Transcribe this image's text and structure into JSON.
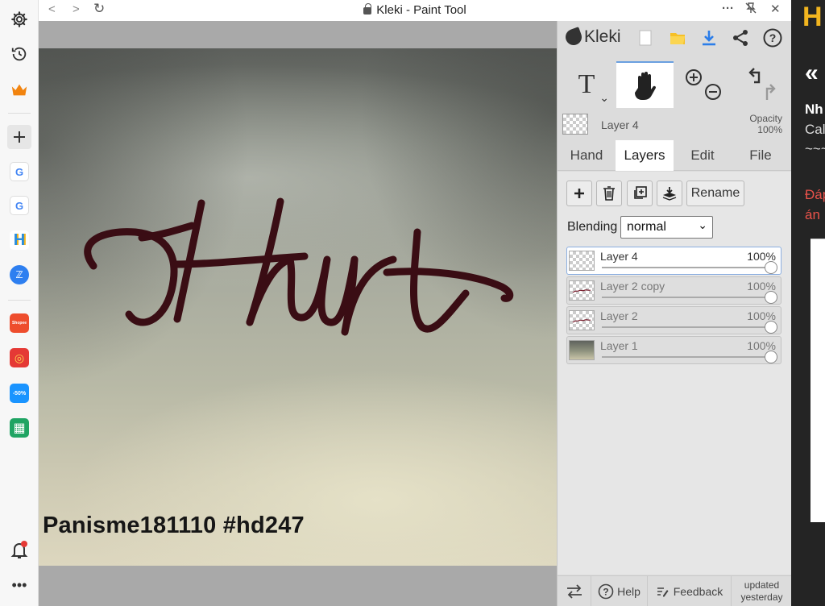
{
  "window": {
    "title": "Kleki - Paint Tool",
    "back_icon": "chevron-left-icon",
    "forward_icon": "chevron-right-icon",
    "reload_icon": "reload-icon",
    "more_label": "···"
  },
  "sidebar": {
    "apps": [
      {
        "name": "google-1",
        "label": "G",
        "color": "#ffffff"
      },
      {
        "name": "google-2",
        "label": "G",
        "color": "#ffffff"
      },
      {
        "name": "hocmai",
        "label": "H",
        "color": "#ffffff"
      },
      {
        "name": "zalo",
        "label": "ℤ",
        "color": "#2e7ff0"
      },
      {
        "name": "shopee",
        "label": "Shopee",
        "color": "#ee4d2d"
      },
      {
        "name": "lazada-game",
        "label": "◎",
        "color": "#e53935"
      },
      {
        "name": "tiki",
        "label": "-50%",
        "color": "#1a94ff"
      },
      {
        "name": "sheets",
        "label": "▦",
        "color": "#1fa463"
      }
    ]
  },
  "canvas": {
    "watermark": "Panisme181110 #hd247",
    "stroke_color": "#3a0d14"
  },
  "panel": {
    "logo": "Kleki",
    "tools": {
      "text_label": "T",
      "active_tool": "hand"
    },
    "current_layer": {
      "name": "Layer 4",
      "opacity_label": "Opacity",
      "opacity_value": "100%"
    },
    "tabs": [
      {
        "label": "Hand",
        "active": false
      },
      {
        "label": "Layers",
        "active": true
      },
      {
        "label": "Edit",
        "active": false
      },
      {
        "label": "File",
        "active": false
      }
    ],
    "layer_actions": {
      "rename_label": "Rename"
    },
    "blending": {
      "label": "Blending",
      "value": "normal"
    },
    "layers": [
      {
        "name": "Layer 4",
        "opacity": "100%",
        "selected": true,
        "thumb": "transparent"
      },
      {
        "name": "Layer 2 copy",
        "opacity": "100%",
        "selected": false,
        "thumb": "sketch"
      },
      {
        "name": "Layer 2",
        "opacity": "100%",
        "selected": false,
        "thumb": "sketch"
      },
      {
        "name": "Layer 1",
        "opacity": "100%",
        "selected": false,
        "thumb": "photo"
      }
    ],
    "footer": {
      "help_label": "Help",
      "feedback_label": "Feedback",
      "updated_line1": "updated",
      "updated_line2": "yesterday"
    }
  },
  "right_page": {
    "logo": "H",
    "back_glyph": "«",
    "line1": "Nh",
    "line2": "Cal",
    "line3": "~~~",
    "line4": "Đáp",
    "line5": "án"
  }
}
